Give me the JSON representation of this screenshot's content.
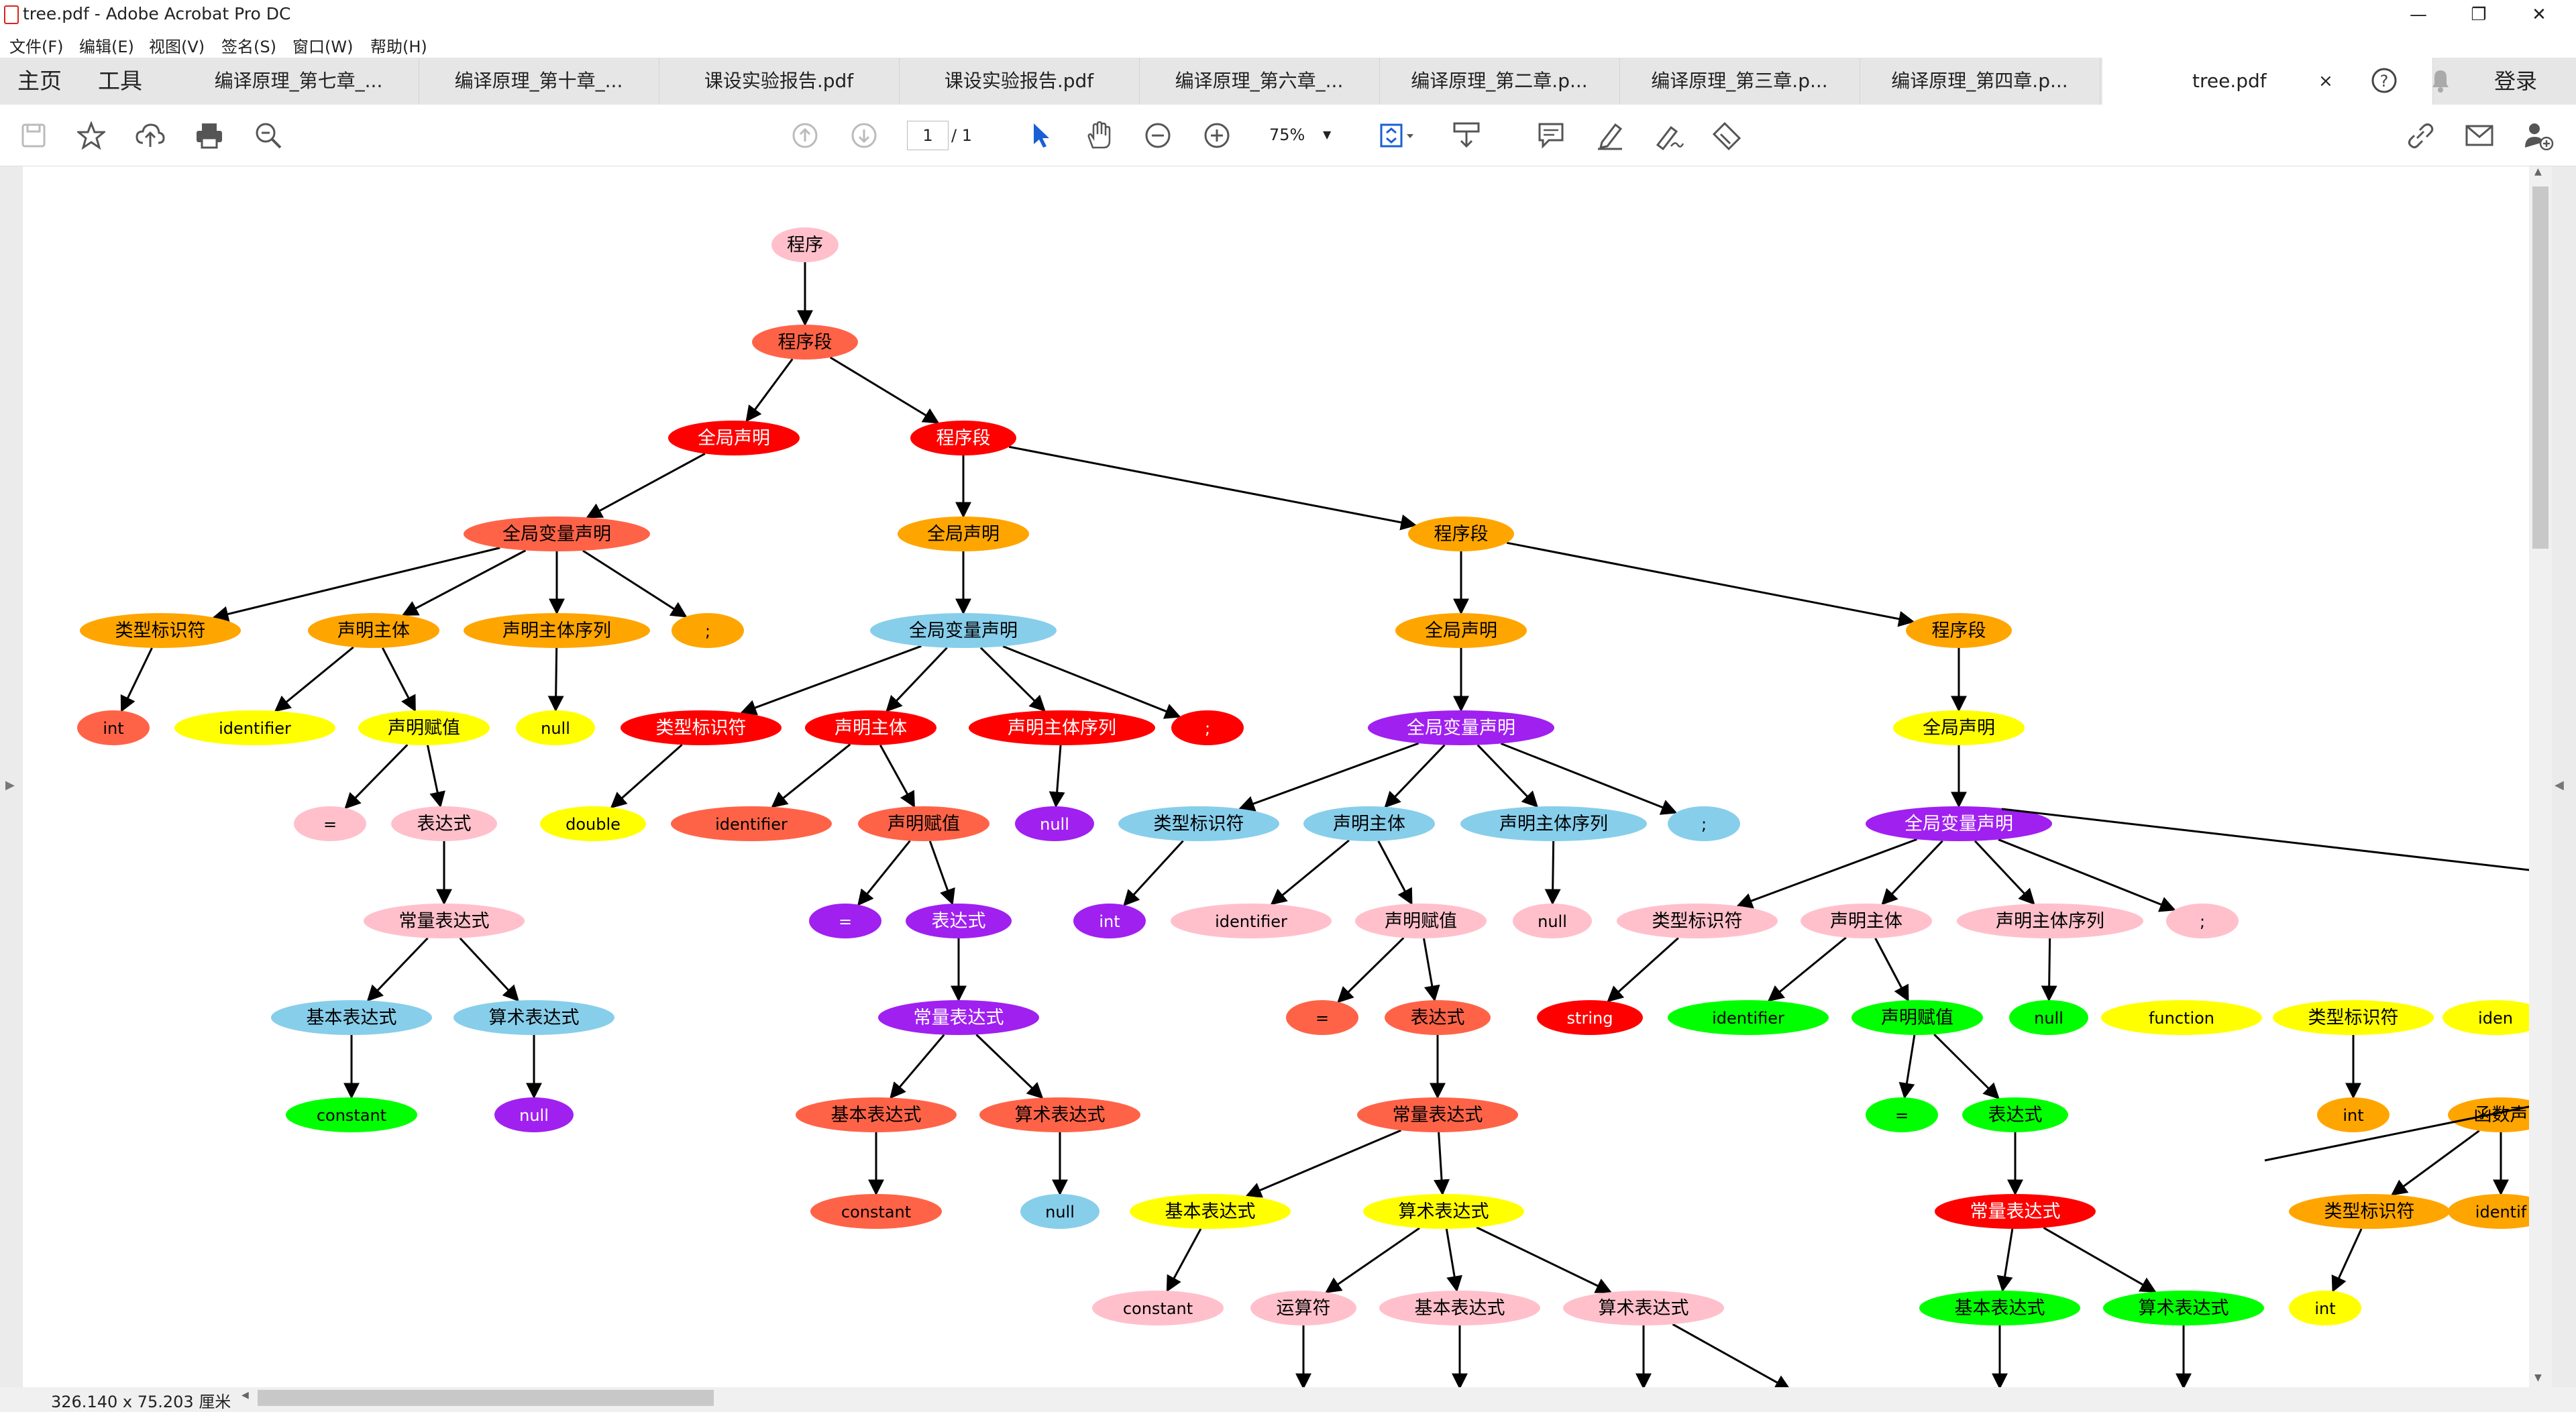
{
  "window": {
    "title": "tree.pdf - Adobe Acrobat Pro DC",
    "controls": {
      "minimize": "—",
      "restore": "❐",
      "close": "✕"
    }
  },
  "menu": [
    "文件(F)",
    "编辑(E)",
    "视图(V)",
    "签名(S)",
    "窗口(W)",
    "帮助(H)"
  ],
  "tabs": {
    "home": "主页",
    "tools": "工具",
    "docs": [
      "编译原理_第七章_...",
      "编译原理_第十章_...",
      "课设实验报告.pdf",
      "课设实验报告.pdf",
      "编译原理_第六章_...",
      "编译原理_第二章.p...",
      "编译原理_第三章.p...",
      "编译原理_第四章.p...",
      "tree.pdf"
    ],
    "close": "×",
    "login": "登录"
  },
  "toolbar": {
    "page_current": "1",
    "page_total": "/ 1",
    "zoom": "75%"
  },
  "status": {
    "size": "326.140 x 75.203 厘米"
  },
  "colors": {
    "pink": "#ffc0cb",
    "tomato": "#ff6347",
    "red": "#ff0000",
    "orange": "#ffa500",
    "skyblue": "#87ceeb",
    "yellow": "#ffff00",
    "purple": "#a020f0",
    "green": "#00ff00"
  },
  "tree": {
    "nodes": [
      {
        "id": "n1",
        "label": "程序",
        "color": "pink"
      },
      {
        "id": "n2",
        "label": "程序段",
        "color": "tomato"
      },
      {
        "id": "n3",
        "label": "全局声明",
        "color": "red"
      },
      {
        "id": "n4",
        "label": "程序段",
        "color": "red"
      },
      {
        "id": "n5",
        "label": "全局变量声明",
        "color": "tomato"
      },
      {
        "id": "n6",
        "label": "类型标识符",
        "color": "orange"
      },
      {
        "id": "n7",
        "label": "声明主体",
        "color": "orange"
      },
      {
        "id": "n8",
        "label": "声明主体序列",
        "color": "orange"
      },
      {
        "id": "n9",
        "label": ";",
        "color": "orange"
      },
      {
        "id": "n10",
        "label": "int",
        "color": "tomato"
      },
      {
        "id": "n11",
        "label": "identifier",
        "color": "yellow"
      },
      {
        "id": "n12",
        "label": "声明赋值",
        "color": "yellow"
      },
      {
        "id": "n13",
        "label": "null",
        "color": "yellow"
      },
      {
        "id": "n14",
        "label": "=",
        "color": "pink"
      },
      {
        "id": "n15",
        "label": "表达式",
        "color": "pink"
      },
      {
        "id": "n16",
        "label": "常量表达式",
        "color": "pink"
      },
      {
        "id": "n17",
        "label": "基本表达式",
        "color": "skyblue"
      },
      {
        "id": "n18",
        "label": "算术表达式",
        "color": "skyblue"
      },
      {
        "id": "n19",
        "label": "constant",
        "color": "green"
      },
      {
        "id": "n20",
        "label": "null",
        "color": "purple"
      },
      {
        "id": "n21",
        "label": "全局声明",
        "color": "orange"
      },
      {
        "id": "n22",
        "label": "程序段",
        "color": "orange"
      },
      {
        "id": "n23",
        "label": "全局变量声明",
        "color": "skyblue"
      },
      {
        "id": "n24",
        "label": "类型标识符",
        "color": "red"
      },
      {
        "id": "n25",
        "label": "声明主体",
        "color": "red"
      },
      {
        "id": "n26",
        "label": "声明主体序列",
        "color": "red"
      },
      {
        "id": "n27",
        "label": ";",
        "color": "red"
      },
      {
        "id": "n28",
        "label": "double",
        "color": "yellow"
      },
      {
        "id": "n29",
        "label": "identifier",
        "color": "tomato"
      },
      {
        "id": "n30",
        "label": "声明赋值",
        "color": "tomato"
      },
      {
        "id": "n31",
        "label": "null",
        "color": "purple"
      },
      {
        "id": "n32",
        "label": "=",
        "color": "purple"
      },
      {
        "id": "n33",
        "label": "表达式",
        "color": "purple"
      },
      {
        "id": "n34",
        "label": "常量表达式",
        "color": "purple"
      },
      {
        "id": "n35",
        "label": "基本表达式",
        "color": "tomato"
      },
      {
        "id": "n36",
        "label": "算术表达式",
        "color": "tomato"
      },
      {
        "id": "n37",
        "label": "constant",
        "color": "tomato"
      },
      {
        "id": "n38",
        "label": "null",
        "color": "skyblue"
      },
      {
        "id": "n39",
        "label": "全局声明",
        "color": "orange"
      },
      {
        "id": "n40",
        "label": "程序段",
        "color": "orange"
      },
      {
        "id": "n41",
        "label": "全局变量声明",
        "color": "purple"
      },
      {
        "id": "n42",
        "label": "类型标识符",
        "color": "skyblue"
      },
      {
        "id": "n43",
        "label": "声明主体",
        "color": "skyblue"
      },
      {
        "id": "n44",
        "label": "声明主体序列",
        "color": "skyblue"
      },
      {
        "id": "n45",
        "label": ";",
        "color": "skyblue"
      },
      {
        "id": "n46",
        "label": "int",
        "color": "purple"
      },
      {
        "id": "n47",
        "label": "identifier",
        "color": "pink"
      },
      {
        "id": "n48",
        "label": "声明赋值",
        "color": "pink"
      },
      {
        "id": "n49",
        "label": "null",
        "color": "pink"
      },
      {
        "id": "n50",
        "label": "=",
        "color": "tomato"
      },
      {
        "id": "n51",
        "label": "表达式",
        "color": "tomato"
      },
      {
        "id": "n52",
        "label": "常量表达式",
        "color": "tomato"
      },
      {
        "id": "n53",
        "label": "基本表达式",
        "color": "yellow"
      },
      {
        "id": "n54",
        "label": "算术表达式",
        "color": "yellow"
      },
      {
        "id": "n55",
        "label": "constant",
        "color": "pink"
      },
      {
        "id": "n56",
        "label": "运算符",
        "color": "pink"
      },
      {
        "id": "n57",
        "label": "基本表达式",
        "color": "pink"
      },
      {
        "id": "n58",
        "label": "算术表达式",
        "color": "pink"
      },
      {
        "id": "n59",
        "label": "全局声明",
        "color": "yellow"
      },
      {
        "id": "n60",
        "label": "全局变量声明",
        "color": "purple"
      },
      {
        "id": "n61",
        "label": "类型标识符",
        "color": "pink"
      },
      {
        "id": "n62",
        "label": "声明主体",
        "color": "pink"
      },
      {
        "id": "n63",
        "label": "声明主体序列",
        "color": "pink"
      },
      {
        "id": "n64",
        "label": ";",
        "color": "pink"
      },
      {
        "id": "n65",
        "label": "string",
        "color": "red"
      },
      {
        "id": "n66",
        "label": "identifier",
        "color": "green"
      },
      {
        "id": "n67",
        "label": "声明赋值",
        "color": "green"
      },
      {
        "id": "n68",
        "label": "null",
        "color": "green"
      },
      {
        "id": "n69",
        "label": "=",
        "color": "green"
      },
      {
        "id": "n70",
        "label": "表达式",
        "color": "green"
      },
      {
        "id": "n71",
        "label": "常量表达式",
        "color": "red"
      },
      {
        "id": "n72",
        "label": "基本表达式",
        "color": "green"
      },
      {
        "id": "n73",
        "label": "算术表达式",
        "color": "green"
      },
      {
        "id": "n74",
        "label": "function",
        "color": "yellow"
      },
      {
        "id": "n75",
        "label": "类型标识符",
        "color": "yellow"
      },
      {
        "id": "n76",
        "label": "iden",
        "color": "yellow"
      },
      {
        "id": "n77",
        "label": "int",
        "color": "orange"
      },
      {
        "id": "n78",
        "label": "函数声",
        "color": "orange"
      },
      {
        "id": "n79",
        "label": "类型标识符",
        "color": "orange"
      },
      {
        "id": "n80",
        "label": "identif",
        "color": "orange"
      },
      {
        "id": "n81",
        "label": "int",
        "color": "yellow"
      },
      {
        "id": "p1",
        "label": "",
        "color": "skyblue"
      },
      {
        "id": "p2",
        "label": "",
        "color": "tomato"
      },
      {
        "id": "p3",
        "label": "",
        "color": "green"
      },
      {
        "id": "p4",
        "label": "",
        "color": "green"
      },
      {
        "id": "p5",
        "label": "",
        "color": "red"
      },
      {
        "id": "p6",
        "label": "",
        "color": "green"
      }
    ],
    "edges": [
      [
        "n1",
        "n2"
      ],
      [
        "n2",
        "n3"
      ],
      [
        "n2",
        "n4"
      ],
      [
        "n3",
        "n5"
      ],
      [
        "n5",
        "n6"
      ],
      [
        "n5",
        "n7"
      ],
      [
        "n5",
        "n8"
      ],
      [
        "n5",
        "n9"
      ],
      [
        "n6",
        "n10"
      ],
      [
        "n7",
        "n11"
      ],
      [
        "n7",
        "n12"
      ],
      [
        "n8",
        "n13"
      ],
      [
        "n12",
        "n14"
      ],
      [
        "n12",
        "n15"
      ],
      [
        "n15",
        "n16"
      ],
      [
        "n16",
        "n17"
      ],
      [
        "n16",
        "n18"
      ],
      [
        "n17",
        "n19"
      ],
      [
        "n18",
        "n20"
      ],
      [
        "n4",
        "n21"
      ],
      [
        "n4",
        "n22"
      ],
      [
        "n21",
        "n23"
      ],
      [
        "n23",
        "n24"
      ],
      [
        "n23",
        "n25"
      ],
      [
        "n23",
        "n26"
      ],
      [
        "n23",
        "n27"
      ],
      [
        "n24",
        "n28"
      ],
      [
        "n25",
        "n29"
      ],
      [
        "n25",
        "n30"
      ],
      [
        "n26",
        "n31"
      ],
      [
        "n30",
        "n32"
      ],
      [
        "n30",
        "n33"
      ],
      [
        "n33",
        "n34"
      ],
      [
        "n34",
        "n35"
      ],
      [
        "n34",
        "n36"
      ],
      [
        "n35",
        "n37"
      ],
      [
        "n36",
        "n38"
      ],
      [
        "n22",
        "n39"
      ],
      [
        "n22",
        "n40"
      ],
      [
        "n39",
        "n41"
      ],
      [
        "n41",
        "n42"
      ],
      [
        "n41",
        "n43"
      ],
      [
        "n41",
        "n44"
      ],
      [
        "n41",
        "n45"
      ],
      [
        "n42",
        "n46"
      ],
      [
        "n43",
        "n47"
      ],
      [
        "n43",
        "n48"
      ],
      [
        "n44",
        "n49"
      ],
      [
        "n48",
        "n50"
      ],
      [
        "n48",
        "n51"
      ],
      [
        "n51",
        "n52"
      ],
      [
        "n52",
        "n53"
      ],
      [
        "n52",
        "n54"
      ],
      [
        "n53",
        "n55"
      ],
      [
        "n54",
        "n56"
      ],
      [
        "n54",
        "n57"
      ],
      [
        "n54",
        "n58"
      ],
      [
        "n40",
        "n59"
      ],
      [
        "n59",
        "n60"
      ],
      [
        "n60",
        "n61"
      ],
      [
        "n60",
        "n62"
      ],
      [
        "n60",
        "n63"
      ],
      [
        "n60",
        "n64"
      ],
      [
        "n61",
        "n65"
      ],
      [
        "n62",
        "n66"
      ],
      [
        "n62",
        "n67"
      ],
      [
        "n63",
        "n68"
      ],
      [
        "n67",
        "n69"
      ],
      [
        "n67",
        "n70"
      ],
      [
        "n70",
        "n71"
      ],
      [
        "n71",
        "n72"
      ],
      [
        "n71",
        "n73"
      ],
      [
        "n75",
        "n77"
      ],
      [
        "n78",
        "n79"
      ],
      [
        "n78",
        "n80"
      ],
      [
        "n79",
        "n81"
      ],
      [
        "n56",
        "p1"
      ],
      [
        "n57",
        "p2"
      ],
      [
        "n58",
        "p3"
      ],
      [
        "n58",
        "p4"
      ],
      [
        "n72",
        "p5"
      ],
      [
        "n73",
        "p6"
      ]
    ]
  }
}
